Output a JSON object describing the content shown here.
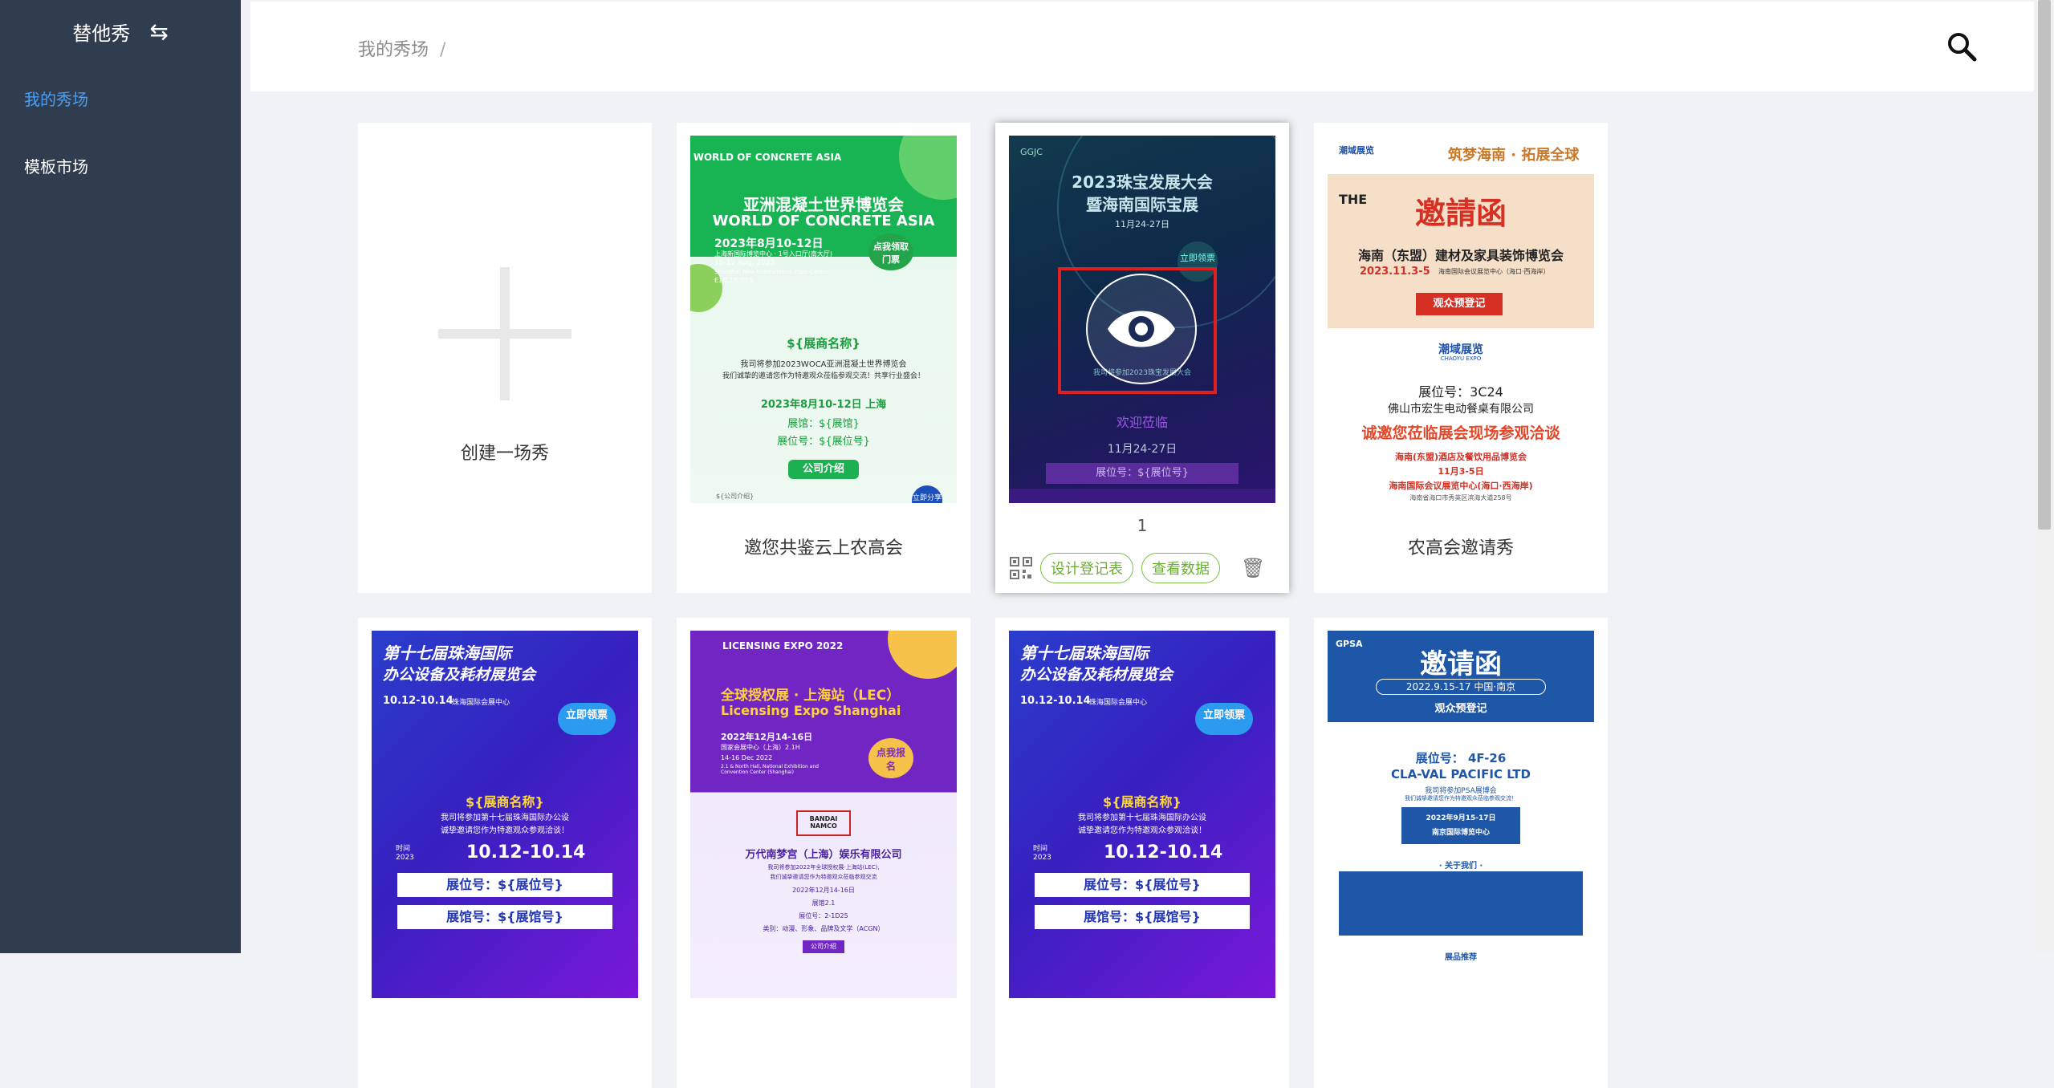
{
  "sidebar": {
    "brand": "替他秀",
    "items": [
      {
        "label": "我的秀场",
        "active": true
      },
      {
        "label": "模板市场",
        "active": false
      }
    ]
  },
  "header": {
    "breadcrumb": "我的秀场",
    "sep": "/"
  },
  "create": {
    "label": "创建一场秀"
  },
  "cards": [
    {
      "title": "邀您共鉴云上农高会",
      "poster": {
        "brand": "WORLD OF CONCRETE ASIA",
        "cn": "亚洲混凝土世界博览会",
        "en": "WORLD OF CONCRETE ASIA",
        "date": "2023年8月10-12日",
        "venue": "上海新国际博览中心 · 1号入口厅(南大厅)",
        "date_en": "10-12 Aug. 2023",
        "venue_en": "Shanghai New International Expo Centre",
        "booth": "E1/E2/E3/E8",
        "sticker": "点我领取门票",
        "company": "${展商名称}",
        "line1": "我司将参加2023WOCA亚洲混凝土世界博览会",
        "line2": "我们诚挚的邀请您作为特邀观众莅临参观交流！共享行业盛会！",
        "when": "2023年8月10-12日 上海",
        "hall": "展馆：${展馆}",
        "boothno": "展位号：${展位号}",
        "intro": "公司介绍",
        "share": "立即分享",
        "small": "${公司介绍}"
      }
    },
    {
      "title": "",
      "number": "1",
      "actions": {
        "design": "设计登记表",
        "data": "查看数据"
      },
      "poster": {
        "logo": "GGJC",
        "cn1": "2023珠宝发展大会",
        "cn2": "暨海南国际宝展",
        "date": "11月24-27日",
        "btn": "立即领票",
        "welcome": "欢迎莅临",
        "line": "我司将参加2023珠宝发展大会",
        "date2": "11月24-27日",
        "booth": "展位号：${展位号}"
      }
    },
    {
      "title": "农高会邀请秀",
      "poster": {
        "slogan": "筑梦海南 · 拓展全球",
        "org": "潮域展览",
        "org_en": "CHAOYU EXPO",
        "card": "THE",
        "inv": "邀請函",
        "expo": "海南（东盟）建材及家具装饰博览会",
        "date": "2023.11.3-5",
        "venue": "海南国际会议展览中心（海口·西海岸）",
        "reg": "观众预登记",
        "booth": "展位号：3C24",
        "company": "佛山市宏生电动餐桌有限公司",
        "invite": "诚邀您莅临展会现场参观洽谈",
        "l1": "海南(东盟)酒店及餐饮用品博览会",
        "l2": "11月3-5日",
        "l3": "海南国际会议展览中心(海口·西海岸)",
        "l4": "海南省海口市秀英区滨海大道258号"
      }
    },
    {
      "title": "",
      "poster": {
        "t1": "第十七届珠海国际",
        "t2": "办公设备及耗材展览会",
        "date": "10.12-10.14",
        "venue": "珠海国际会展中心",
        "btn": "立即领票",
        "company": "${展商名称}",
        "l1": "我司将参加第十七届珠海国际办公设",
        "l2": "诚挚邀请您作为特邀观众参观洽谈！",
        "time": "时间",
        "year": "2023",
        "date2": "10.12-10.14",
        "booth": "展位号：${展位号}",
        "hall": "展馆号：${展馆号}"
      }
    },
    {
      "title": "",
      "poster": {
        "logo": "LICENSING EXPO 2022",
        "cn": "全球授权展 · 上海站（LEC）",
        "en": "Licensing Expo Shanghai",
        "date": "2022年12月14-16日",
        "venue": "国家会展中心（上海）2.1H",
        "date_en": "14-16 Dec 2022",
        "venue_en": "2.1 & North Hall, National Exhibition and Convention Center (Shanghai)",
        "btn": "点我报名",
        "brand": "BANDAI NAMCO",
        "company": "万代南梦宫（上海）娱乐有限公司",
        "l1": "我司将参加2022年全球授权展·上海站(LEC),",
        "l2": "我们诚挚邀请您作为特邀观众莅临参观交流",
        "d": "2022年12月14-16日",
        "h": "展馆2.1",
        "b": "展位号：2-1D25",
        "c": "类别：动漫、形象、品牌及文学（ACGN）",
        "intro": "公司介绍"
      }
    },
    {
      "title": "",
      "poster": {
        "t1": "第十七届珠海国际",
        "t2": "办公设备及耗材展览会",
        "date": "10.12-10.14",
        "venue": "珠海国际会展中心",
        "btn": "立即领票",
        "company": "${展商名称}",
        "l1": "我司将参加第十七届珠海国际办公设",
        "l2": "诚挚邀请您作为特邀观众参观洽谈！",
        "time": "时间",
        "year": "2023",
        "date2": "10.12-10.14",
        "booth": "展位号：${展位号}",
        "hall": "展馆号：${展馆号}"
      }
    },
    {
      "title": "",
      "poster": {
        "logo": "GPSA",
        "inv": "邀请函",
        "date": "2022.9.15-17 中国·南京",
        "reg": "观众预登记",
        "booth": "展位号： 4F-26",
        "company": "CLA-VAL PACIFIC LTD",
        "l1": "我司将参加PSA展博会",
        "l2": "我们诚挚邀请您作为特邀观众莅临参观交流！",
        "d1": "2022年9月15-17日",
        "d2": "南京国际博览中心",
        "about": "· 关于我们 ·",
        "prod": "展品推荐"
      }
    }
  ]
}
